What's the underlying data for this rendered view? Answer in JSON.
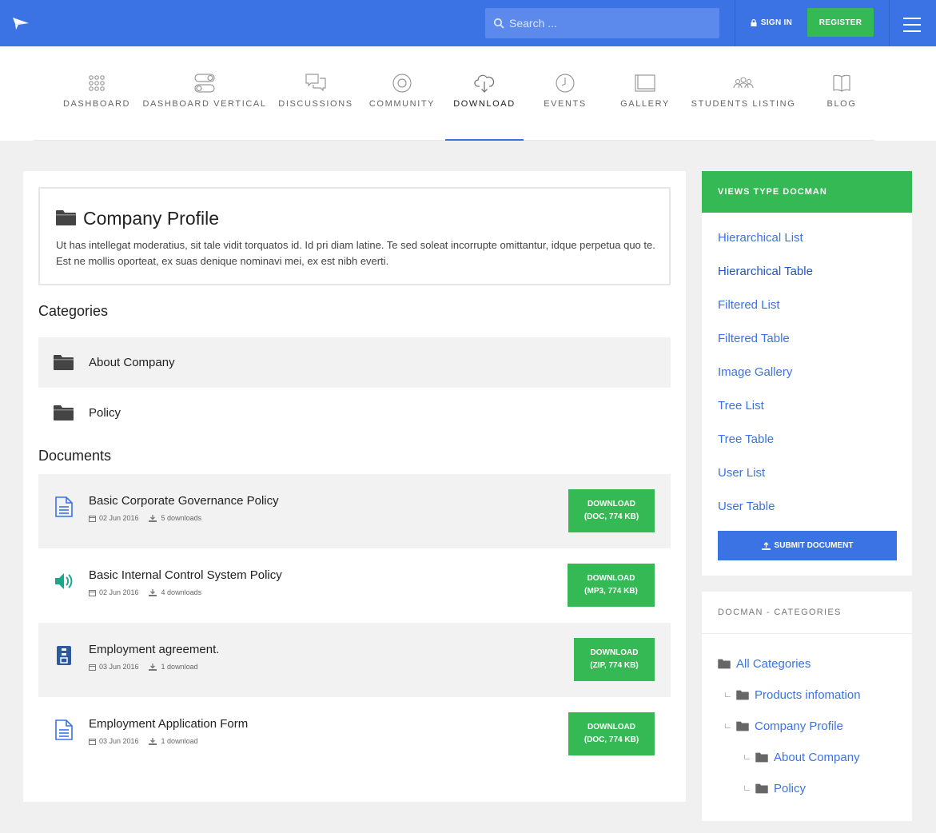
{
  "header": {
    "search_placeholder": "Search ...",
    "signin_label": "SIGN IN",
    "register_label": "REGISTER"
  },
  "nav": {
    "items": [
      {
        "label": "DASHBOARD",
        "icon": "dashboard-grid-icon"
      },
      {
        "label": "DASHBOARD VERTICAL",
        "icon": "toggle-icon"
      },
      {
        "label": "DISCUSSIONS",
        "icon": "chat-bubbles-icon"
      },
      {
        "label": "COMMUNITY",
        "icon": "circle-icon"
      },
      {
        "label": "DOWNLOAD",
        "icon": "cloud-download-icon"
      },
      {
        "label": "EVENTS",
        "icon": "clock-icon"
      },
      {
        "label": "GALLERY",
        "icon": "gallery-icon"
      },
      {
        "label": "STUDENTS LISTING",
        "icon": "people-icon"
      },
      {
        "label": "BLOG",
        "icon": "book-icon"
      }
    ],
    "active": "DOWNLOAD"
  },
  "profile": {
    "title": "Company Profile",
    "description": "Ut has intellegat moderatius, sit tale vidit torquatos id. Id pri diam latine. Te sed soleat incorrupte omittantur, idque perpetua quo te. Est ne mollis oporteat, ex suas denique nominavi mei, ex est nibh everti."
  },
  "categories": {
    "heading": "Categories",
    "items": [
      "About Company",
      "Policy"
    ]
  },
  "documents": {
    "heading": "Documents",
    "items": [
      {
        "title": "Basic Corporate Governance Policy",
        "date": "02 Jun 2016",
        "downloads": "5 downloads",
        "btn_line1": "DOWNLOAD",
        "btn_line2": "(DOC, 774 KB)",
        "icon": "document-icon"
      },
      {
        "title": "Basic Internal Control System Policy",
        "date": "02 Jun 2016",
        "downloads": "4 downloads",
        "btn_line1": "DOWNLOAD",
        "btn_line2": "(MP3, 774 KB)",
        "icon": "audio-icon"
      },
      {
        "title": "Employment agreement.",
        "date": "03 Jun 2016",
        "downloads": "1 download",
        "btn_line1": "DOWNLOAD",
        "btn_line2": "(ZIP, 774 KB)",
        "icon": "archive-icon"
      },
      {
        "title": "Employment Application Form",
        "date": "03 Jun 2016",
        "downloads": "1 download",
        "btn_line1": "DOWNLOAD",
        "btn_line2": "(DOC, 774 KB)",
        "icon": "document-icon"
      }
    ]
  },
  "views": {
    "heading": "VIEWS TYPE DOCMAN",
    "links": [
      "Hierarchical List",
      "Hierarchical Table",
      "Filtered List",
      "Filtered Table",
      "Image Gallery",
      "Tree List",
      "Tree Table",
      "User List",
      "User Table"
    ],
    "submit_label": "SUBMIT DOCUMENT"
  },
  "docman_categories": {
    "heading": "DOCMAN - CATEGORIES",
    "items": [
      "All Categories",
      "Products infomation",
      "Company Profile",
      "About Company",
      "Policy"
    ]
  },
  "colors": {
    "primary_blue": "#3b73e4",
    "green": "#34b955",
    "icon_blue": "#3b73e4",
    "audio_teal": "#19a98a",
    "archive_navy": "#2b5a9e"
  }
}
